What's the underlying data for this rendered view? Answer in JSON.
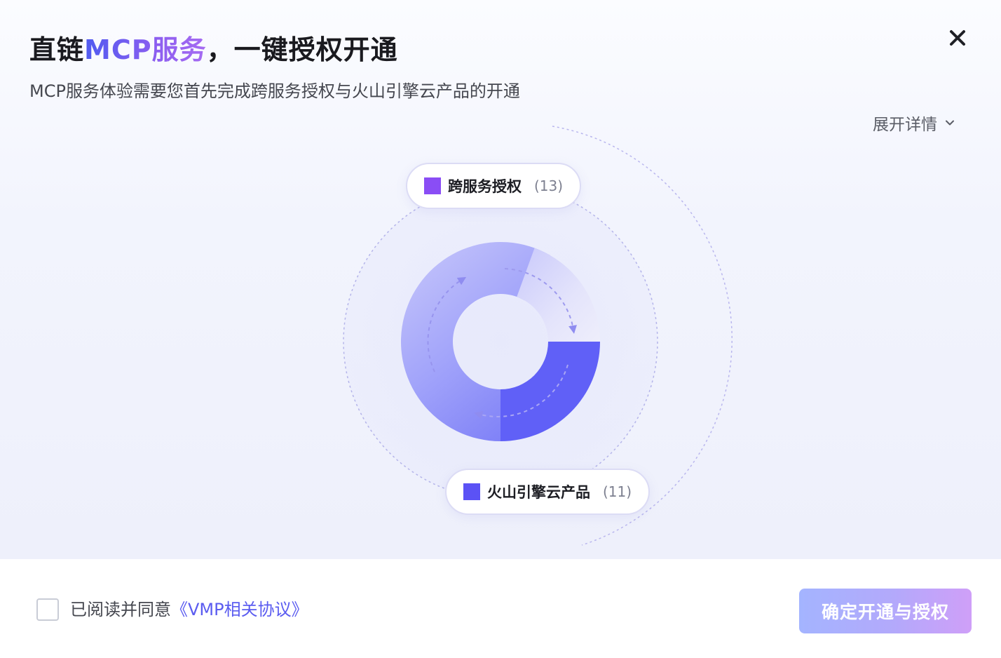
{
  "dialog": {
    "title_prefix": "直链",
    "title_highlight": "MCP服务",
    "title_suffix": "，一键授权开通",
    "subtitle": "MCP服务体验需要您首先完成跨服务授权与火山引擎云产品的开通",
    "close_icon": "close-icon",
    "expand_label": "展开详情",
    "expand_icon": "chevron-down-icon"
  },
  "diagram": {
    "items": [
      {
        "label": "跨服务授权",
        "count": "(13)",
        "value": 13,
        "color": "#8a4df5"
      },
      {
        "label": "火山引擎云产品",
        "count": "(11)",
        "value": 11,
        "color": "#5b52f5"
      }
    ]
  },
  "footer": {
    "agree_text": "已阅读并同意",
    "agree_link": "《VMP相关协议》",
    "confirm_label": "确定开通与授权"
  }
}
